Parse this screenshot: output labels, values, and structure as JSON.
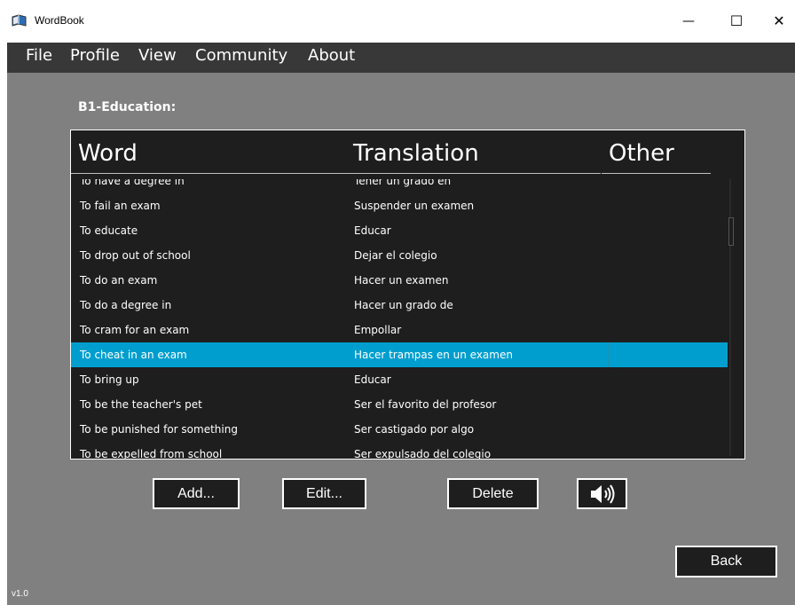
{
  "window": {
    "title": "WordBook",
    "minimize_glyph": "—",
    "maximize_glyph": "☐",
    "close_glyph": "✕",
    "icon": "book-icon"
  },
  "menu": [
    "File",
    "Profile",
    "View",
    "Community",
    "About"
  ],
  "section_title": "B1-Education:",
  "table": {
    "headers": {
      "word": "Word",
      "translation": "Translation",
      "other": "Other"
    },
    "rows": [
      {
        "word": "To have a degree in",
        "translation": "Tener un grado en",
        "other": ""
      },
      {
        "word": "To fail an exam",
        "translation": "Suspender un examen",
        "other": ""
      },
      {
        "word": "To educate",
        "translation": "Educar",
        "other": ""
      },
      {
        "word": "To drop out of school",
        "translation": "Dejar el colegio",
        "other": ""
      },
      {
        "word": "To do an exam",
        "translation": "Hacer un examen",
        "other": ""
      },
      {
        "word": "To do a degree in",
        "translation": "Hacer un grado de",
        "other": ""
      },
      {
        "word": "To cram for an exam",
        "translation": "Empollar",
        "other": ""
      },
      {
        "word": "To cheat in an exam",
        "translation": "Hacer trampas en un examen",
        "other": "",
        "selected": true
      },
      {
        "word": "To bring up",
        "translation": "Educar",
        "other": ""
      },
      {
        "word": "To be the teacher's pet",
        "translation": "Ser el favorito del profesor",
        "other": ""
      },
      {
        "word": "To be punished for something",
        "translation": "Ser castigado por algo",
        "other": ""
      },
      {
        "word": "To be expelled from school",
        "translation": "Ser expulsado del colegio",
        "other": ""
      }
    ]
  },
  "buttons": {
    "add": "Add...",
    "edit": "Edit...",
    "delete": "Delete",
    "sound_icon": "speaker-icon",
    "back": "Back"
  },
  "version": "v1.0",
  "colors": {
    "background": "#808080",
    "menubar": "#383838",
    "list_background": "#1e1e1e",
    "selection": "#009ecf",
    "text": "#ffffff"
  }
}
